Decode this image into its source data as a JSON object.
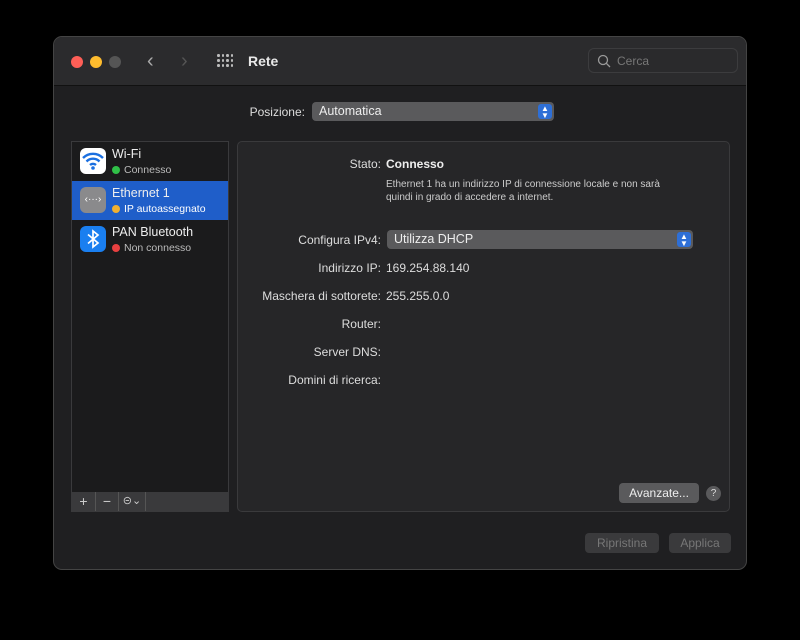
{
  "window": {
    "title": "Rete",
    "search_placeholder": "Cerca"
  },
  "location": {
    "label": "Posizione:",
    "value": "Automatica"
  },
  "services": [
    {
      "name": "Wi-Fi",
      "status": "Connesso",
      "status_color": "#30c048"
    },
    {
      "name": "Ethernet 1",
      "status": "IP autoassegnato",
      "status_color": "#f0b030"
    },
    {
      "name": "PAN Bluetooth",
      "status": "Non connesso",
      "status_color": "#e84040"
    }
  ],
  "sidebar_toolbar": {
    "add": "+",
    "remove": "−",
    "action": "⊝⌄"
  },
  "detail": {
    "status_label": "Stato:",
    "status_value": "Connesso",
    "status_desc_1": "Ethernet 1 ha un indirizzo IP di connessione locale e non sarà",
    "status_desc_2": "quindi in grado di accedere a internet.",
    "ipv4_label": "Configura IPv4:",
    "ipv4_value": "Utilizza DHCP",
    "ip_label": "Indirizzo IP:",
    "ip_value": "169.254.88.140",
    "mask_label": "Maschera di sottorete:",
    "mask_value": "255.255.0.0",
    "router_label": "Router:",
    "dns_label": "Server DNS:",
    "domains_label": "Domini di ricerca:",
    "advanced": "Avanzate...",
    "help": "?"
  },
  "footer": {
    "revert": "Ripristina",
    "apply": "Applica"
  }
}
